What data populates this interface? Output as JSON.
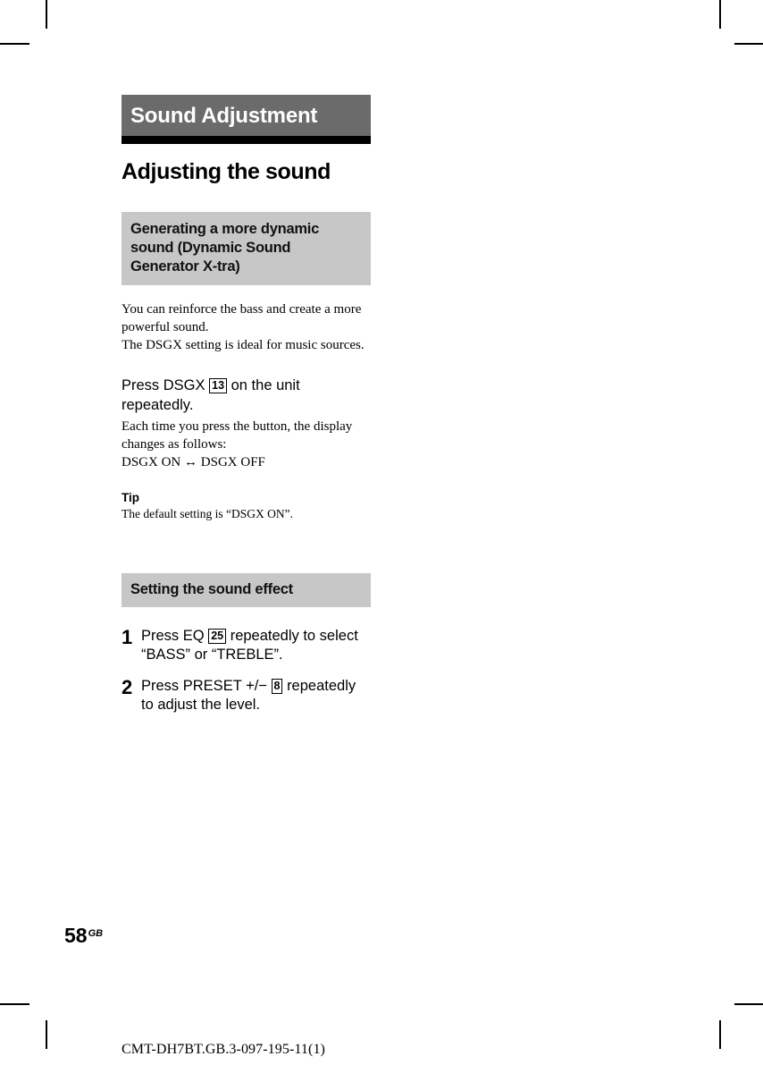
{
  "document": {
    "folio_number": "58",
    "folio_suffix": "GB",
    "doc_code": "CMT-DH7BT.GB.3-097-195-11(1)"
  },
  "colors": {
    "chapter_bar_bg": "#6b6b6b",
    "chapter_bar_rule": "#000000",
    "chapter_bar_text": "#ffffff",
    "subhead_box_bg": "#c7c7c7",
    "body_text": "#000000",
    "page_bg": "#ffffff"
  },
  "chapter": {
    "title": "Sound Adjustment"
  },
  "section": {
    "heading": "Adjusting the sound"
  },
  "subsection_dsgx": {
    "box_title": "Generating a more dynamic sound (Dynamic Sound Generator X-tra)",
    "intro_lines": [
      "You can reinforce the bass and create a more powerful sound.",
      "The DSGX setting is ideal for music sources."
    ],
    "instruction_prefix": "Press DSGX",
    "instruction_ref": "13",
    "instruction_suffix": "on the unit repeatedly.",
    "detail_line_1": "Each time you press the button, the display changes as follows:",
    "toggle_left": "DSGX ON",
    "toggle_arrow": "↔",
    "toggle_right": "DSGX OFF",
    "tip_label": "Tip",
    "tip_text": "The default setting is “DSGX ON”."
  },
  "subsection_sound_effect": {
    "box_title": "Setting the sound effect",
    "steps": [
      {
        "number": "1",
        "text_before_ref": "Press EQ",
        "ref": "25",
        "text_after_ref": "repeatedly to select “BASS” or “TREBLE”."
      },
      {
        "number": "2",
        "text_before_ref": "Press PRESET +/−",
        "ref": "8",
        "text_after_ref": "repeatedly to adjust the level."
      }
    ]
  }
}
